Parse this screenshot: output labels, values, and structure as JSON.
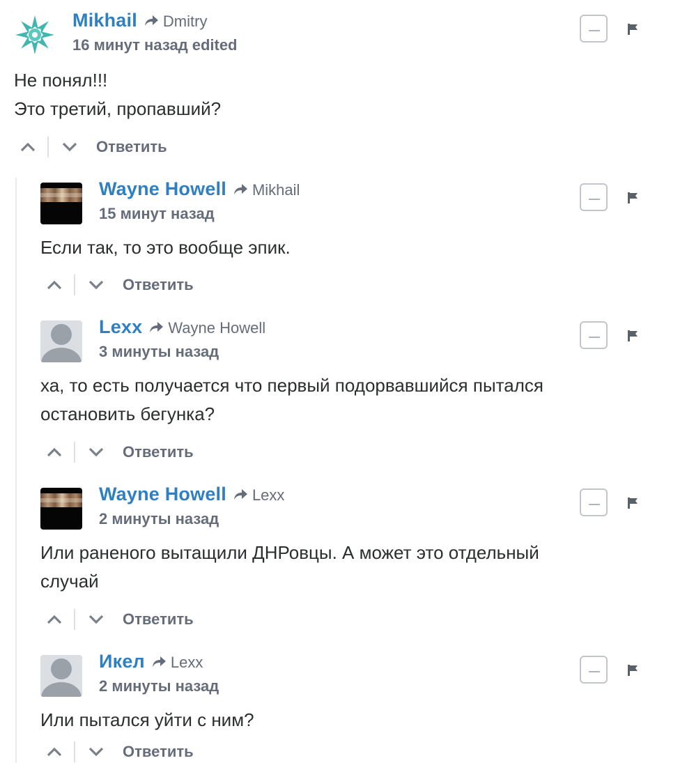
{
  "actions": {
    "reply_label": "Ответить"
  },
  "comments": [
    {
      "author": "Mikhail",
      "parent": "Dmitry",
      "time": "16 минут назад",
      "edited": "edited",
      "avatar": "snowflake-avatar",
      "lines": [
        "Не понял!!!",
        "Это третий, пропавший?"
      ]
    },
    {
      "author": "Wayne Howell",
      "parent": "Mikhail",
      "time": "15 минут назад",
      "avatar": "photo-avatar",
      "lines": [
        "Если так, то это вообще эпик."
      ]
    },
    {
      "author": "Lexx",
      "parent": "Wayne Howell",
      "time": "3 минуты назад",
      "avatar": "default-avatar",
      "lines": [
        "ха, то есть получается что первый подорвавшийся пытался",
        "остановить бегунка?"
      ]
    },
    {
      "author": "Wayne Howell",
      "parent": "Lexx",
      "time": "2 минуты назад",
      "avatar": "photo-avatar",
      "lines": [
        "Или раненого вытащили ДНРовцы. А может это отдельный",
        "случай"
      ]
    },
    {
      "author": "Икел",
      "parent": "Lexx",
      "time": "2 минуты назад",
      "avatar": "default-avatar",
      "lines": [
        "Или пытался уйти с ним?"
      ]
    }
  ],
  "colors": {
    "author": "#2f80c3",
    "meta": "#656c7a",
    "text": "#2a2e2e"
  }
}
